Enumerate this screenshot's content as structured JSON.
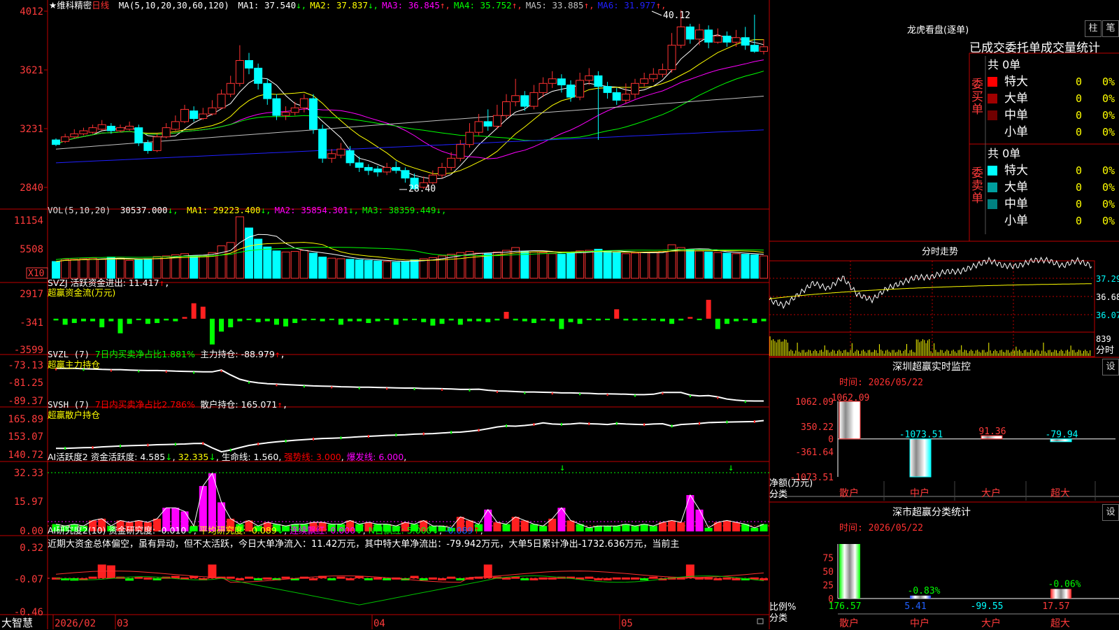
{
  "stock": {
    "name": "★维科精密",
    "period": "日线"
  },
  "kline_header": {
    "ma_def": "MA(5,10,20,30,60,120)",
    "items": [
      {
        "label": "MA1: 37.540",
        "arrow": "↓",
        "color": "#ffffff"
      },
      {
        "label": "MA2: 37.837",
        "arrow": "↓",
        "color": "#ffff00"
      },
      {
        "label": "MA3: 36.845",
        "arrow": "↑",
        "color": "#ff00ff"
      },
      {
        "label": "MA4: 35.752",
        "arrow": "↑",
        "color": "#00ff00"
      },
      {
        "label": "MA5: 33.885",
        "arrow": "↑",
        "color": "#c0c0c0"
      },
      {
        "label": "MA6: 31.977",
        "arrow": "↑",
        "color": "#2020ff"
      }
    ],
    "y_ticks": [
      "4012",
      "3621",
      "3231",
      "2840"
    ],
    "high_label": "40.12",
    "low_label": "28.40"
  },
  "vol_header": {
    "def": "VOL(5,10,20)",
    "value": "30537.000",
    "items": [
      {
        "label": "MA1: 29223.400",
        "arrow": "↓",
        "color": "#ffff00"
      },
      {
        "label": "MA2: 35854.301",
        "arrow": "↓",
        "color": "#ff00ff"
      },
      {
        "label": "MA3: 38359.449",
        "arrow": "↓",
        "color": "#00ff00"
      }
    ],
    "y_ticks": [
      "11154",
      "5508"
    ],
    "unit": "X10"
  },
  "svzj": {
    "title": "SVZJ  活跃资金进出: 11.417",
    "arrow": "↑",
    "sub": "超赢资金流(万元)",
    "y_ticks": [
      "2917",
      "-341",
      "-3599"
    ]
  },
  "svzl": {
    "title": "SVZL (7)",
    "a": "7日内买卖净占比1.881%",
    "b": "主力持仓: -88.979",
    "arrow": "↑",
    "sub": "超赢主力持仓",
    "y_ticks": [
      "-73.13",
      "-81.25",
      "-89.37"
    ]
  },
  "svsh": {
    "title": "SVSH (7)",
    "a": "7日内买卖净占比2.786%",
    "b": "散户持仓: 165.071",
    "arrow": "↑",
    "sub": "超赢散户持仓",
    "y_ticks": [
      "165.89",
      "153.07",
      "140.72"
    ]
  },
  "ai_active": {
    "title": "AI活跃度2",
    "a": "资金活跃度: 4.585",
    "a_arrow": "↓",
    "b": "32.335",
    "b_arrow": "↓",
    "c": "生命线: 1.560",
    "d": "强势线: 3.000",
    "e": "爆发线: 6.000",
    "y_ticks": [
      "32.33",
      "15.97",
      "0.00"
    ]
  },
  "ai_research": {
    "title": "AI研究度2(10)",
    "a": "资金研究度: -0.010",
    "a_arrow": "↓",
    "b": "平均研究度: -0.089",
    "b_arrow": "↓",
    "c": "连续飘红: 0.000",
    "c_arrow": "↓",
    "d": "N日飘红: 5.000",
    "d_arrow": "↓",
    "e": "-0.089",
    "e_arrow": "↑",
    "note": "近期大资金总体偏空，虽有异动，但不太活跃，今日大单净流入：11.42万元，其中特大单净流出：-79.942万元，大单5日累计净出-1732.636万元，当前主",
    "y_ticks": [
      "0.32",
      "-0.07",
      "-0.46"
    ]
  },
  "bottom_axis": {
    "brand": "大智慧",
    "labels": [
      "2026/02",
      "03",
      "04",
      "05"
    ]
  },
  "dragon": {
    "title": "龙虎看盘(逐单)",
    "btn1": "柱",
    "btn2": "笔",
    "subtitle": "已成交委托单成交量统计",
    "buy": {
      "side": "委买单",
      "total": "共 0单",
      "rows": [
        {
          "name": "特大",
          "v": "0",
          "p": "0%",
          "color": "#ff0000"
        },
        {
          "name": "大单",
          "v": "0",
          "p": "0%",
          "color": "#a00000"
        },
        {
          "name": "中单",
          "v": "0",
          "p": "0%",
          "color": "#700000"
        },
        {
          "name": "小单",
          "v": "0",
          "p": "0%",
          "color": ""
        }
      ]
    },
    "sell": {
      "side": "委卖单",
      "total": "共 0单",
      "rows": [
        {
          "name": "特大",
          "v": "0",
          "p": "0%",
          "color": "#00ffff"
        },
        {
          "name": "大单",
          "v": "0",
          "p": "0%",
          "color": "#00a0a0"
        },
        {
          "name": "中单",
          "v": "0",
          "p": "0%",
          "color": "#008080"
        },
        {
          "name": "小单",
          "v": "0",
          "p": "0%",
          "color": ""
        }
      ]
    }
  },
  "intraday": {
    "title": "分时走势",
    "y_ticks": [
      "37.29",
      "36.68",
      "36.07"
    ],
    "vol": "839",
    "unit": "分时"
  },
  "monitor": {
    "title": "深圳超赢实时监控",
    "btn": "设",
    "time": "时间: 2026/05/22",
    "y_ticks": [
      "1062.09",
      "350.22",
      "0",
      "-361.64",
      "-1073.51"
    ],
    "ylabel": "净额(万元)",
    "xlabel": "分类",
    "bars": [
      {
        "cat": "散户",
        "value": 1062.09,
        "label": "1062.09"
      },
      {
        "cat": "中户",
        "value": -1073.51,
        "label": "-1073.51"
      },
      {
        "cat": "大户",
        "value": 91.36,
        "label": "91.36"
      },
      {
        "cat": "超大",
        "value": -79.94,
        "label": "-79.94"
      }
    ]
  },
  "classify": {
    "title": "深市超赢分类统计",
    "btn": "设",
    "time": "时间: 2026/05/22",
    "y_ticks": [
      "75",
      "50",
      "25",
      "0"
    ],
    "ylabel": "比例%",
    "xlabel": "分类",
    "bars": [
      {
        "cat": "散户",
        "pct": "176.57",
        "above": "",
        "value": 100
      },
      {
        "cat": "中户",
        "pct": "5.41",
        "above": "-0.83%",
        "value": 5.41
      },
      {
        "cat": "大户",
        "pct": "-99.55",
        "above": "",
        "value": 0
      },
      {
        "cat": "超大",
        "pct": "17.57",
        "above": "-0.06%",
        "value": 17.57
      }
    ]
  },
  "chart_data": [
    {
      "type": "candlestick",
      "title": "日线",
      "ylim": [
        28.4,
        40.12
      ],
      "ohlc": [
        [
          31.6,
          31.3,
          31.7,
          31.2
        ],
        [
          31.5,
          31.8,
          32.0,
          31.4
        ],
        [
          31.8,
          32.0,
          32.3,
          31.7
        ],
        [
          32.0,
          32.2,
          32.4,
          31.9
        ],
        [
          32.1,
          32.4,
          32.6,
          32.0
        ],
        [
          32.3,
          32.6,
          32.9,
          32.2
        ],
        [
          32.5,
          32.2,
          32.7,
          32.0
        ],
        [
          32.2,
          32.4,
          32.6,
          32.1
        ],
        [
          32.3,
          32.5,
          32.8,
          32.2
        ],
        [
          32.4,
          31.4,
          32.6,
          31.2
        ],
        [
          31.4,
          30.9,
          31.6,
          30.7
        ],
        [
          30.9,
          31.8,
          32.0,
          30.8
        ],
        [
          31.8,
          32.4,
          32.7,
          31.7
        ],
        [
          32.3,
          32.8,
          33.2,
          32.2
        ],
        [
          32.8,
          33.6,
          33.9,
          32.7
        ],
        [
          33.5,
          33.0,
          33.8,
          32.8
        ],
        [
          33.0,
          33.3,
          33.7,
          32.9
        ],
        [
          33.3,
          33.7,
          34.2,
          33.2
        ],
        [
          33.7,
          34.6,
          34.9,
          33.6
        ],
        [
          34.6,
          35.3,
          35.8,
          34.4
        ],
        [
          35.3,
          36.8,
          37.8,
          35.1
        ],
        [
          36.8,
          36.3,
          37.3,
          35.9
        ],
        [
          36.3,
          35.3,
          36.6,
          34.9
        ],
        [
          35.3,
          34.3,
          35.6,
          33.9
        ],
        [
          34.3,
          33.2,
          34.6,
          32.9
        ],
        [
          33.2,
          33.4,
          33.8,
          32.9
        ],
        [
          33.4,
          33.7,
          34.1,
          33.2
        ],
        [
          33.7,
          34.3,
          34.6,
          33.4
        ],
        [
          34.3,
          32.3,
          34.6,
          32.0
        ],
        [
          32.3,
          30.4,
          32.6,
          30.1
        ],
        [
          30.4,
          30.7,
          31.0,
          30.1
        ],
        [
          30.6,
          31.0,
          31.4,
          30.4
        ],
        [
          30.9,
          30.1,
          31.2,
          29.9
        ],
        [
          30.1,
          29.8,
          30.5,
          29.5
        ],
        [
          29.8,
          29.6,
          30.0,
          29.3
        ],
        [
          29.7,
          29.5,
          29.9,
          29.2
        ],
        [
          29.5,
          29.8,
          30.1,
          29.3
        ],
        [
          29.8,
          29.6,
          30.2,
          29.4
        ],
        [
          29.6,
          29.1,
          29.8,
          28.8
        ],
        [
          29.1,
          28.4,
          29.4,
          28.4
        ],
        [
          28.5,
          28.8,
          29.2,
          28.4
        ],
        [
          28.8,
          29.3,
          29.6,
          28.7
        ],
        [
          29.3,
          29.8,
          30.1,
          29.1
        ],
        [
          29.8,
          30.4,
          30.8,
          29.6
        ],
        [
          30.4,
          31.3,
          31.6,
          30.2
        ],
        [
          31.3,
          32.1,
          32.7,
          31.1
        ],
        [
          32.1,
          32.8,
          33.3,
          31.9
        ],
        [
          32.8,
          32.5,
          33.6,
          32.2
        ],
        [
          32.5,
          33.2,
          33.9,
          32.3
        ],
        [
          33.2,
          34.1,
          34.6,
          33.0
        ],
        [
          34.1,
          34.5,
          35.6,
          33.8
        ],
        [
          34.5,
          33.8,
          34.8,
          33.5
        ],
        [
          33.8,
          34.7,
          35.2,
          33.6
        ],
        [
          34.7,
          35.3,
          35.7,
          34.4
        ],
        [
          35.3,
          35.6,
          36.1,
          35.0
        ],
        [
          35.6,
          35.2,
          35.9,
          34.7
        ],
        [
          35.2,
          34.4,
          35.5,
          34.1
        ],
        [
          34.4,
          35.5,
          36.0,
          34.2
        ],
        [
          35.5,
          35.8,
          36.3,
          35.2
        ],
        [
          35.8,
          35.1,
          36.1,
          31.6
        ],
        [
          35.1,
          34.7,
          35.4,
          34.3
        ],
        [
          34.7,
          34.2,
          35.0,
          33.9
        ],
        [
          34.2,
          34.6,
          35.3,
          34.0
        ],
        [
          34.6,
          35.3,
          35.6,
          34.3
        ],
        [
          35.3,
          35.6,
          36.0,
          35.1
        ],
        [
          35.6,
          35.9,
          36.3,
          35.4
        ],
        [
          35.9,
          36.2,
          36.6,
          35.7
        ],
        [
          36.2,
          37.8,
          38.6,
          36.0
        ],
        [
          37.8,
          39.0,
          40.1,
          37.6
        ],
        [
          39.0,
          38.2,
          39.2,
          37.9
        ],
        [
          38.2,
          38.8,
          39.2,
          37.8
        ],
        [
          38.8,
          38.0,
          39.1,
          37.6
        ],
        [
          38.0,
          38.4,
          38.9,
          37.9
        ],
        [
          38.4,
          38.0,
          38.7,
          37.7
        ],
        [
          38.0,
          38.3,
          38.8,
          37.7
        ],
        [
          38.3,
          37.8,
          39.0,
          37.5
        ],
        [
          37.8,
          37.4,
          39.8,
          37.3
        ],
        [
          37.4,
          37.7,
          38.2,
          37.2
        ]
      ]
    },
    {
      "type": "bar",
      "title": "VOL(5,10,20)",
      "values": [
        30,
        34,
        34,
        35,
        36,
        34,
        38,
        36,
        32,
        33,
        35,
        39,
        40,
        42,
        44,
        40,
        41,
        46,
        58,
        64,
        110,
        90,
        70,
        56,
        49,
        47,
        48,
        50,
        45,
        38,
        36,
        35,
        34,
        33,
        32,
        31,
        30,
        29,
        30,
        33,
        35,
        37,
        40,
        43,
        46,
        48,
        45,
        44,
        47,
        50,
        55,
        48,
        47,
        46,
        44,
        43,
        46,
        49,
        50,
        52,
        48,
        46,
        44,
        45,
        46,
        47,
        48,
        60,
        55,
        51,
        49,
        47,
        46,
        45,
        44,
        43,
        42,
        40
      ]
    },
    {
      "type": "bar",
      "title": "超赢资金流(万元)",
      "ylim": [
        -3599,
        2917
      ],
      "values": [
        -200,
        -700,
        -500,
        -300,
        -300,
        -1000,
        -300,
        -1700,
        -600,
        -100,
        -600,
        -500,
        -200,
        -300,
        200,
        1800,
        1400,
        -3000,
        -1500,
        -1000,
        -300,
        -100,
        -400,
        -300,
        -700,
        -900,
        -500,
        -200,
        -100,
        -300,
        -100,
        -700,
        -300,
        -300,
        -500,
        -300,
        -100,
        -700,
        -200,
        -100,
        -400,
        -800,
        -600,
        -200,
        -700,
        -300,
        -300,
        -400,
        -200,
        800,
        -200,
        -300,
        -500,
        -200,
        -300,
        -1200,
        -400,
        -600,
        -100,
        -200,
        -100,
        1100,
        -200,
        -200,
        -100,
        -200,
        -300,
        -600,
        -200,
        200,
        -100,
        2200,
        -1200,
        -600,
        -300,
        -200,
        -500,
        -300,
        -100,
        -200,
        -300
      ]
    },
    {
      "type": "line",
      "title": "超赢主力持仓",
      "ylim": [
        -89.37,
        -73.13
      ],
      "values": [
        -74,
        -74,
        -74,
        -74.2,
        -74.3,
        -74.5,
        -74.6,
        -74.6,
        -74.8,
        -74.9,
        -75,
        -75,
        -75.1,
        -75.3,
        -75.4,
        -75.5,
        -75.6,
        -75.6,
        -74.8,
        -77,
        -79,
        -80,
        -80.6,
        -81,
        -81.2,
        -81.4,
        -81.6,
        -81.8,
        -82,
        -82.1,
        -82.2,
        -82.4,
        -82.5,
        -82.6,
        -82.6,
        -82.7,
        -82.8,
        -82.9,
        -83,
        -83,
        -83.2,
        -83.2,
        -83.3,
        -83.4,
        -83.6,
        -83.6,
        -83.5,
        -84,
        -84.3,
        -84.4,
        -84.6,
        -84.8,
        -84.8,
        -84.9,
        -85,
        -85.2,
        -85.2,
        -85.3,
        -85.4,
        -85.6,
        -85.6,
        -85.7,
        -85.8,
        -86,
        -86,
        -85.8,
        -85,
        -85,
        -85,
        -86.2,
        -86.6,
        -86.4,
        -87,
        -88,
        -88.5,
        -88.8,
        -88.9,
        -88.9,
        -88.9
      ]
    },
    {
      "type": "line",
      "title": "超赢散户持仓",
      "ylim": [
        140.72,
        165.89
      ],
      "values": [
        145,
        145,
        145.2,
        145.4,
        145.5,
        146,
        146.3,
        146.6,
        146.8,
        147,
        147.2,
        147.5,
        147.6,
        147.8,
        148,
        148.3,
        148.4,
        145.3,
        142.6,
        143.8,
        145.5,
        147,
        148,
        148.8,
        149.5,
        150,
        150.6,
        151,
        151.4,
        151.8,
        152,
        152.2,
        152.6,
        153,
        153.3,
        153.6,
        154,
        154.2,
        154.4,
        154.8,
        155,
        155.2,
        155.6,
        156,
        156.2,
        156.8,
        157.5,
        158.6,
        159.8,
        160.5,
        160.3,
        160.8,
        161.5,
        162.6,
        161.8,
        161.6,
        161.8,
        162.4,
        162,
        161.8,
        161.5,
        162.2,
        161.8,
        161.6,
        161.4,
        161.8,
        162,
        160.4,
        161.5,
        161.8,
        162.2,
        162.8,
        163,
        163.2,
        163.3,
        163.4,
        163.5,
        164.2,
        165.1
      ]
    },
    {
      "type": "bar",
      "title": "AI活跃度2",
      "ylim": [
        0,
        32.33
      ],
      "values": [
        4,
        3,
        4,
        3,
        6,
        7,
        3,
        6,
        5,
        6,
        5,
        7,
        13,
        13,
        11,
        3,
        25,
        32,
        16,
        7,
        4,
        6,
        3,
        5,
        4,
        3,
        4,
        4,
        5,
        5,
        4,
        4,
        6,
        4,
        5,
        4,
        4,
        3,
        5,
        4,
        6,
        3,
        3,
        2,
        8,
        6,
        4,
        12,
        5,
        4,
        8,
        6,
        4,
        3,
        7,
        13,
        6,
        4,
        2,
        3,
        3,
        3,
        4,
        3,
        4,
        3,
        5,
        6,
        5,
        20,
        12,
        2,
        5,
        6,
        5,
        4,
        2,
        4,
        6,
        3
      ]
    },
    {
      "type": "bar",
      "title": "AI研究度2(10)",
      "ylim": [
        -0.46,
        0.32
      ],
      "values": [
        -0.06,
        -0.09,
        -0.1,
        -0.07,
        -0.05,
        0.1,
        0.09,
        -0.05,
        -0.1,
        -0.05,
        -0.06,
        -0.09,
        -0.05,
        -0.04,
        -0.06,
        -0.04,
        -0.07,
        0.1,
        -0.05,
        -0.05,
        -0.07,
        -0.05,
        -0.09,
        -0.06,
        -0.08,
        -0.05,
        -0.08,
        -0.05,
        -0.07,
        -0.04,
        -0.08,
        -0.05,
        -0.07,
        -0.04,
        -0.08,
        -0.06,
        -0.09,
        -0.06,
        -0.08,
        -0.04,
        -0.08,
        -0.06,
        -0.07,
        -0.05,
        -0.08,
        -0.06,
        -0.05,
        0.1,
        -0.05,
        -0.06,
        -0.05,
        -0.08,
        -0.07,
        -0.06,
        -0.06,
        -0.05,
        -0.05,
        -0.06,
        -0.05,
        -0.07,
        -0.07,
        -0.06,
        -0.06,
        -0.06,
        -0.08,
        -0.05,
        -0.07,
        -0.06,
        -0.06,
        0.1,
        -0.06,
        -0.06,
        -0.07,
        -0.06,
        -0.07,
        -0.08,
        -0.06,
        -0.07,
        -0.06
      ]
    },
    {
      "type": "line",
      "title": "分时走势",
      "ylim": [
        36.07,
        37.29
      ],
      "values": [
        36.6,
        36.5,
        36.7,
        36.9,
        36.8,
        37.0,
        36.7,
        36.6,
        36.8,
        36.9,
        37.0,
        37.0,
        37.1,
        37.1,
        37.2,
        37.3,
        37.2,
        37.2,
        37.3,
        37.3,
        37.2,
        37.3,
        37.2
      ]
    }
  ]
}
